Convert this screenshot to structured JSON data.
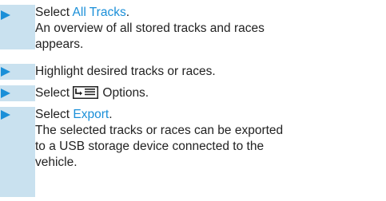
{
  "colors": {
    "bar": "#c9e1ef",
    "arrow": "#1a8fd8",
    "link": "#1a8fd8",
    "text": "#222222"
  },
  "steps": [
    {
      "prefix": "Select ",
      "link": "All Tracks",
      "suffix": ".",
      "result_lines": [
        "An overview of all stored tracks and races",
        "appears."
      ]
    },
    {
      "text": "Highlight desired tracks or races."
    },
    {
      "prefix": "Select ",
      "icon": "options-list-icon",
      "suffix": "Options."
    },
    {
      "prefix": "Select ",
      "link": "Export",
      "suffix": ".",
      "result_lines": [
        "The selected tracks or races can be exported",
        "to a USB storage device connected to the",
        "vehicle."
      ]
    }
  ]
}
